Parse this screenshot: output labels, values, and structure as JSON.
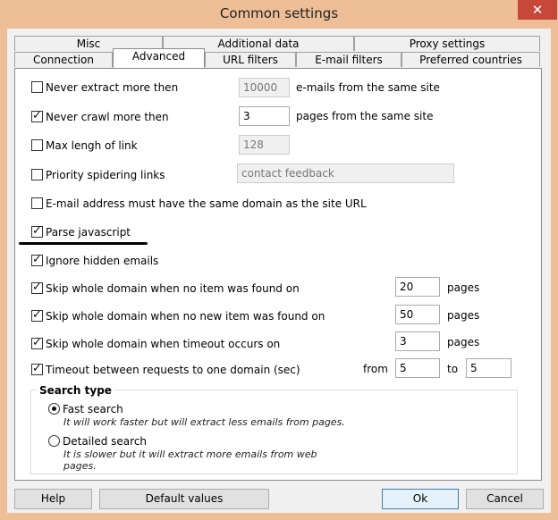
{
  "window": {
    "title": "Common settings",
    "close_glyph": "✕"
  },
  "tabs_row1": [
    "Misc",
    "Additional data",
    "Proxy settings"
  ],
  "tabs_row2": [
    "Connection",
    "Advanced",
    "URL filters",
    "E-mail filters",
    "Preferred countries"
  ],
  "active_tab": "Advanced",
  "options": {
    "never_extract": {
      "label": "Never extract more then",
      "checked": false,
      "value": "10000",
      "suffix": "e-mails from the same site"
    },
    "never_crawl": {
      "label": "Never crawl more then",
      "checked": true,
      "value": "3",
      "suffix": "pages from the same site"
    },
    "max_length": {
      "label": "Max lengh of link",
      "checked": false,
      "value": "128"
    },
    "priority": {
      "label": "Priority spidering links",
      "checked": false,
      "value": "contact feedback"
    },
    "same_domain": {
      "label": "E-mail address must have the same domain as the site URL",
      "checked": false
    },
    "parse_js": {
      "label": "Parse javascript",
      "checked": true
    },
    "ignore_hidden": {
      "label": "Ignore hidden emails",
      "checked": true
    },
    "skip_no_item": {
      "label": "Skip whole domain when no item was found on",
      "checked": true,
      "value": "20",
      "suffix": "pages"
    },
    "skip_no_new": {
      "label": "Skip whole domain when no new item was found on",
      "checked": true,
      "value": "50",
      "suffix": "pages"
    },
    "skip_timeout": {
      "label": "Skip whole domain when timeout occurs on",
      "checked": true,
      "value": "3",
      "suffix": "pages"
    },
    "timeout_between": {
      "label": "Timeout between requests to one domain (sec)",
      "checked": true,
      "from_label": "from",
      "from_value": "5",
      "to_label": "to",
      "to_value": "5"
    }
  },
  "search_type": {
    "title": "Search type",
    "fast": {
      "label": "Fast search",
      "desc": "It will work faster but will extract less emails from pages.",
      "selected": true
    },
    "detailed": {
      "label": "Detailed search",
      "desc1": "It is slower but it will extract more emails from web",
      "desc2": "pages.",
      "selected": false
    }
  },
  "buttons": {
    "help": "Help",
    "defaults": "Default values",
    "ok": "Ok",
    "cancel": "Cancel"
  }
}
